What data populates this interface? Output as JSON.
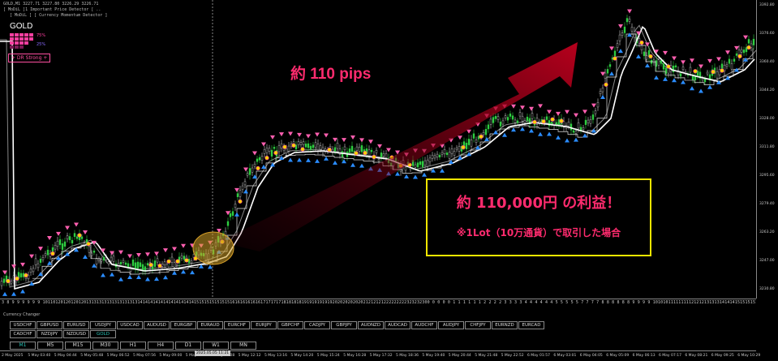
{
  "header": {
    "info_line1": "GOLD,M1  3227.71 3227.80 3226.29 3226.71",
    "info_line2": "[ MoDiL ]1 Important Price Detector [ ..",
    "info_line3": "[ MoDiL ] [ Currency Momentum Detector ]",
    "symbol": "GOLD",
    "pct_top": "75%",
    "pct_bottom": "25%",
    "trend_badge": "+ DR Strong +"
  },
  "annotations": {
    "pips": "約 110 pips",
    "profit_title": "約 110,000円 の利益！",
    "profit_note": "※1Lot（10万通貨）で取引した場合"
  },
  "price_axis": [
    "3392.80",
    "3376.60",
    "3360.40",
    "3344.20",
    "3328.00",
    "3311.80",
    "3295.60",
    "3279.40",
    "3263.20",
    "3247.00",
    "3230.80"
  ],
  "date_digits": "3 8 9 9 9 9 9 9 1011012012012012013131313131313131313141414141414141414141415151515151515161616161616171717171818181819191919191920202020202021212121222222222323232300 0 0 0 0 1 1 1 1 1 1 2 2 2 2 3 3 3 3 4 4 4 4 4 4 5 5 5 5 5  7 7 7 7 8 8 8 8 8 8 9 9 9 9 101010111111111212121313131414141515151516161616171717181818",
  "currency_changer": {
    "title": "Currency Changer",
    "rows": [
      [
        "USDCHF",
        "GBPUSD",
        "EURUSD",
        "USDJPY",
        "USDCAD",
        "AUDUSD",
        "EURGBP",
        "EURAUD",
        "EURCHF",
        "EURJPY",
        "GBPCHF",
        "CADJPY",
        "GBPJPY",
        "AUDNZD",
        "AUDCAD",
        "AUDCHF",
        "AUDJPY",
        "CHFJPY",
        "EURNZD",
        "EURCAD"
      ],
      [
        "CADCHF",
        "NZDJPY",
        "NZDUSD",
        "GOLD"
      ]
    ],
    "active": "GOLD"
  },
  "timeframes": [
    "M1",
    "M5",
    "M15",
    "M30",
    "H1",
    "H4",
    "D1",
    "W1",
    "MN"
  ],
  "active_timeframe": "M1",
  "time_axis": {
    "labels": [
      "2 May 2025",
      "5 May 03:40",
      "5 May 04:44",
      "5 May 05:48",
      "5 May 06:52",
      "5 May 07:56",
      "5 May 09:00",
      "5 May 10:04",
      "5 May 11:08",
      "5 May 12:12",
      "5 May 13:16",
      "5 May 14:20",
      "5 May 15:24",
      "5 May 16:28",
      "5 May 17:32",
      "5 May 18:36",
      "5 May 19:40",
      "5 May 20:44",
      "5 May 21:48",
      "5 May 22:52",
      "6 May 01:57",
      "6 May 03:01",
      "6 May 04:05",
      "6 May 05:09",
      "6 May 06:13",
      "6 May 07:17",
      "6 May 08:21",
      "6 May 09:25",
      "6 May 10:29"
    ],
    "marker": "2025.05.05 11:21"
  },
  "colors": {
    "trend_line": "#ffffff",
    "ma_line": "#888888",
    "up_arrow": "#2a8cff",
    "down_arrow": "#ff5fb0",
    "big_arrow": "#b0001b",
    "box_border": "#f2e600",
    "annotation_text": "#ff2b6e",
    "active_button": "#27c2b5"
  }
}
